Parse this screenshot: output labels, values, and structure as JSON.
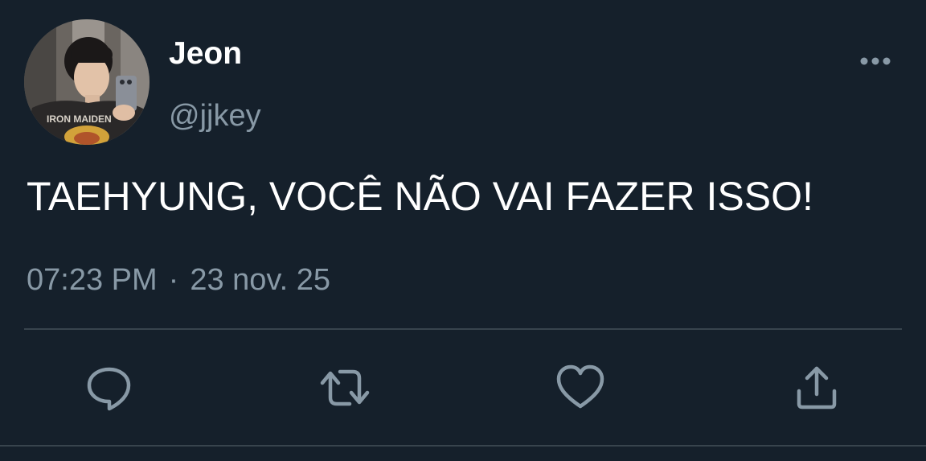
{
  "author": {
    "display_name": "Jeon",
    "handle": "@jjkey",
    "avatar_shirt_text": "IRON MAIDEN"
  },
  "tweet": {
    "text": "TAEHYUNG, VOCÊ NÃO VAI FAZER ISSO!",
    "time": "07:23 PM",
    "separator": "·",
    "date": "23 nov. 25"
  },
  "icons": {
    "more": "more-horizontal-icon",
    "reply": "reply-icon",
    "retweet": "retweet-icon",
    "like": "heart-icon",
    "share": "share-icon"
  },
  "colors": {
    "background": "#15202b",
    "primary_text": "#ffffff",
    "secondary_text": "#8899a6",
    "divider": "#38444d"
  }
}
